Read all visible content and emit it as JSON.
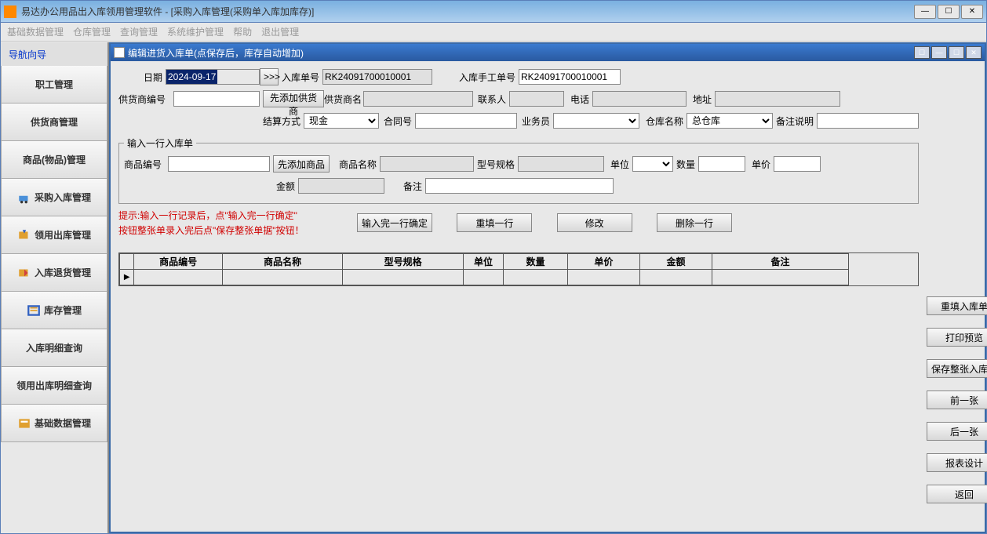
{
  "app": {
    "title": "易达办公用品出入库领用管理软件   - [采购入库管理(采购单入库加库存)]"
  },
  "menubar": [
    "基础数据管理",
    "仓库管理",
    "查询管理",
    "系统维护管理",
    "帮助",
    "退出管理"
  ],
  "sidebar": {
    "header": "导航向导",
    "items": [
      {
        "label": "职工管理"
      },
      {
        "label": "供货商管理"
      },
      {
        "label": "商品(物品)管理"
      },
      {
        "label": "采购入库管理"
      },
      {
        "label": "领用出库管理"
      },
      {
        "label": "入库退货管理"
      },
      {
        "label": "库存管理"
      },
      {
        "label": "入库明细查询"
      },
      {
        "label": "领用出库明细查询"
      },
      {
        "label": "基础数据管理"
      }
    ]
  },
  "inner": {
    "title": "编辑进货入库单(点保存后，库存自动增加)",
    "fields": {
      "date_label": "日期",
      "date_value": "2024-09-17",
      "arrow": ">>>",
      "in_no_label": "入库单号",
      "in_no_value": "RK24091700010001",
      "manual_no_label": "入库手工单号",
      "manual_no_value": "RK24091700010001",
      "supplier_code_label": "供货商编号",
      "add_supplier_btn": "先添加供货商",
      "supplier_name_label": "供货商名",
      "contact_label": "联系人",
      "phone_label": "电话",
      "address_label": "地址",
      "settle_label": "结算方式",
      "settle_value": "现金",
      "contract_label": "合同号",
      "salesman_label": "业务员",
      "warehouse_label": "仓库名称",
      "warehouse_value": "总仓库",
      "note_label": "备注说明"
    },
    "line_group": {
      "legend": "输入一行入库单",
      "product_code_label": "商品编号",
      "add_product_btn": "先添加商品",
      "product_name_label": "商品名称",
      "spec_label": "型号规格",
      "unit_label": "单位",
      "qty_label": "数量",
      "price_label": "单价",
      "amount_label": "金额",
      "remark_label": "备注"
    },
    "hint_line1": "提示:输入一行记录后，点\"输入完一行确定\"",
    "hint_line2": "按钮整张单录入完后点\"保存整张单据\"按钮！",
    "actions": {
      "confirm_line": "输入完一行确定",
      "refill_line": "重填一行",
      "modify": "修改",
      "delete_line": "删除一行"
    },
    "table_headers": [
      "商品编号",
      "商品名称",
      "型号规格",
      "单位",
      "数量",
      "单价",
      "金额",
      "备注"
    ],
    "right_buttons": [
      "重填入库单",
      "打印预览",
      "保存整张入库单",
      "前一张",
      "后一张",
      "报表设计",
      "返回"
    ]
  }
}
